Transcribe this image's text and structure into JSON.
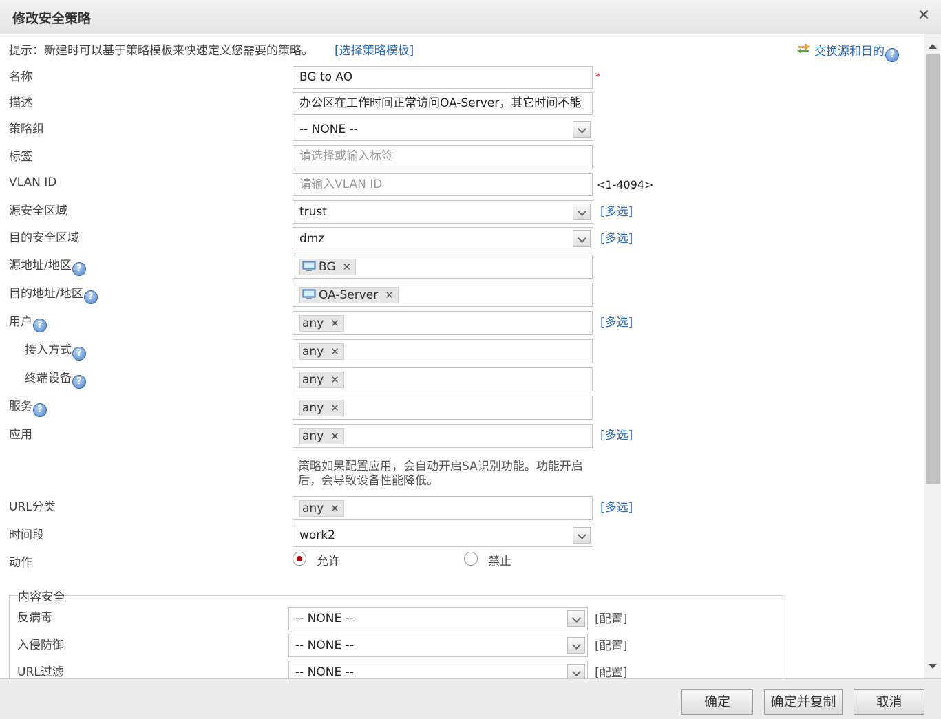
{
  "dialog": {
    "title": "修改安全策略",
    "close_glyph": "✕"
  },
  "hint": {
    "text": "提示：新建时可以基于策略模板来快速定义您需要的策略。",
    "template_link": "[选择策略模板]",
    "swap_link": "交换源和目的"
  },
  "help_glyph": "?",
  "required_mark": "*",
  "multi_select": "[多选]",
  "config_link": "[配置]",
  "remove_glyph": "✕",
  "fields": {
    "name": {
      "label": "名称",
      "value": "BG to AO"
    },
    "description": {
      "label": "描述",
      "value": "办公区在工作时间正常访问OA-Server，其它时间不能"
    },
    "policy_group": {
      "label": "策略组",
      "value": "-- NONE --"
    },
    "tag": {
      "label": "标签",
      "placeholder": "请选择或输入标签"
    },
    "vlan": {
      "label": "VLAN ID",
      "placeholder": "请输入VLAN ID",
      "range": "<1-4094>"
    },
    "src_zone": {
      "label": "源安全区域",
      "value": "trust"
    },
    "dst_zone": {
      "label": "目的安全区域",
      "value": "dmz"
    },
    "src_addr": {
      "label": "源地址/地区",
      "value": "BG"
    },
    "dst_addr": {
      "label": "目的地址/地区",
      "value": "OA-Server"
    },
    "user": {
      "label": "用户",
      "value": "any"
    },
    "access_mode": {
      "label": "接入方式",
      "value": "any"
    },
    "terminal": {
      "label": "终端设备",
      "value": "any"
    },
    "service": {
      "label": "服务",
      "value": "any"
    },
    "application": {
      "label": "应用",
      "value": "any",
      "note_line1": "策略如果配置应用，会自动开启SA识别功能。功能开启",
      "note_line2": "后，会导致设备性能降低。"
    },
    "url_category": {
      "label": "URL分类",
      "value": "any"
    },
    "time_range": {
      "label": "时间段",
      "value": "work2"
    },
    "action": {
      "label": "动作",
      "allow": "允许",
      "deny": "禁止",
      "selected": "allow"
    }
  },
  "content_security": {
    "legend": "内容安全",
    "antivirus": {
      "label": "反病毒",
      "value": "-- NONE --"
    },
    "ips": {
      "label": "入侵防御",
      "value": "-- NONE --"
    },
    "url_filter": {
      "label": "URL过滤",
      "value": "-- NONE --"
    }
  },
  "buttons": {
    "ok": "确定",
    "ok_copy": "确定并复制",
    "cancel": "取消"
  }
}
